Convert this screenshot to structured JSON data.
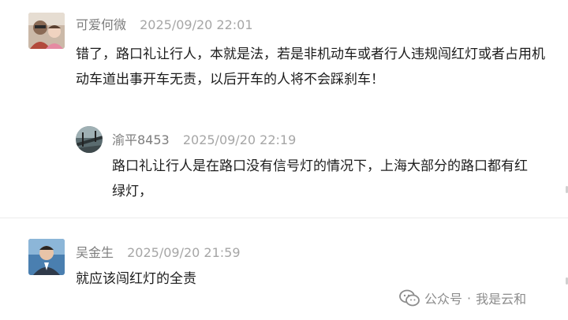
{
  "comments": [
    {
      "name": "可爱何微",
      "time": "2025/09/20 22:01",
      "text": "错了，路口礼让行人，本就是法，若是非机动车或者行人违规闯红灯或者占用机动车道出事开车无责，以后开车的人将不会踩刹车！",
      "avatar": "family-photo-avatar",
      "reply": {
        "name": "渝平8453",
        "time": "2025/09/20 22:19",
        "text": "路口礼让行人是在路口没有信号灯的情况下，上海大部分的路口都有红绿灯，",
        "avatar": "bridge-photo-avatar"
      }
    },
    {
      "name": "吴金生",
      "time": "2025/09/20 21:59",
      "text": "就应该闯红灯的全责",
      "avatar": "portrait-photo-avatar"
    }
  ],
  "watermark": {
    "source": "公众号",
    "separator": "·",
    "account": "我是云和"
  },
  "colors": {
    "name": "#7d7d7d",
    "time": "#a6a6a6",
    "text": "#1c1c1c",
    "divider": "#ececec"
  }
}
